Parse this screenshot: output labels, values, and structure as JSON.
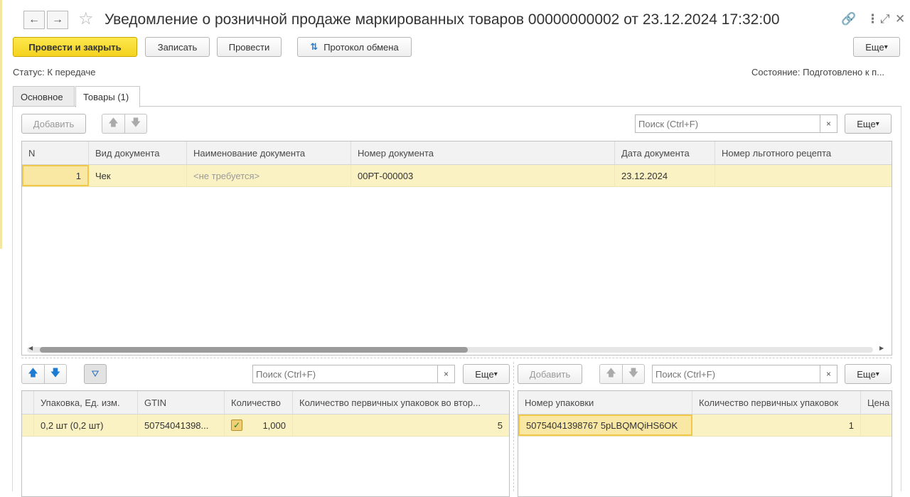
{
  "window": {
    "title": "Уведомление о розничной продаже маркированных товаров 00000000002 от 23.12.2024 17:32:00"
  },
  "icons": {
    "back": "arrow-left-icon",
    "forward": "arrow-right-icon",
    "favorite": "star-icon",
    "link": "link-icon",
    "menu": "more-vert-icon",
    "fullscreen": "expand-icon",
    "close": "close-icon"
  },
  "toolbar": {
    "post_close": "Провести и закрыть",
    "save": "Записать",
    "post": "Провести",
    "exchange_log": "Протокол обмена",
    "more": "Еще"
  },
  "status": {
    "label": "Статус:",
    "value": "К передаче",
    "state_label": "Состояние:",
    "state_value": "Подготовлено к п..."
  },
  "tabs": [
    {
      "label": "Основное"
    },
    {
      "label": "Товары (1)"
    }
  ],
  "docs": {
    "add": "Добавить",
    "search_placeholder": "Поиск (Ctrl+F)",
    "clear": "×",
    "more": "Еще",
    "columns": [
      "N",
      "Вид документа",
      "Наименование документа",
      "Номер документа",
      "Дата документа",
      "Номер льготного рецепта"
    ],
    "rows": [
      {
        "n": "1",
        "type": "Чек",
        "name": "<не требуется>",
        "number": "00РТ-000003",
        "date": "23.12.2024",
        "recipe": ""
      }
    ]
  },
  "goods": {
    "search_placeholder": "Поиск (Ctrl+F)",
    "clear": "×",
    "more": "Еще",
    "columns": [
      "Упаковка, Ед. изм.",
      "GTIN",
      "Количество",
      "Количество первичных упаковок во втор..."
    ],
    "rows": [
      {
        "pack": "0,2 шт (0,2 шт)",
        "gtin": "50754041398...",
        "qty": "1,000",
        "primary": "5"
      }
    ]
  },
  "packages": {
    "add": "Добавить",
    "search_placeholder": "Поиск (Ctrl+F)",
    "clear": "×",
    "more": "Еще",
    "columns": [
      "Номер упаковки",
      "Количество первичных упаковок",
      "Цена"
    ],
    "rows": [
      {
        "code": "50754041398767 5pLBQMQiHS6OK",
        "count": "1",
        "price": ""
      }
    ]
  }
}
